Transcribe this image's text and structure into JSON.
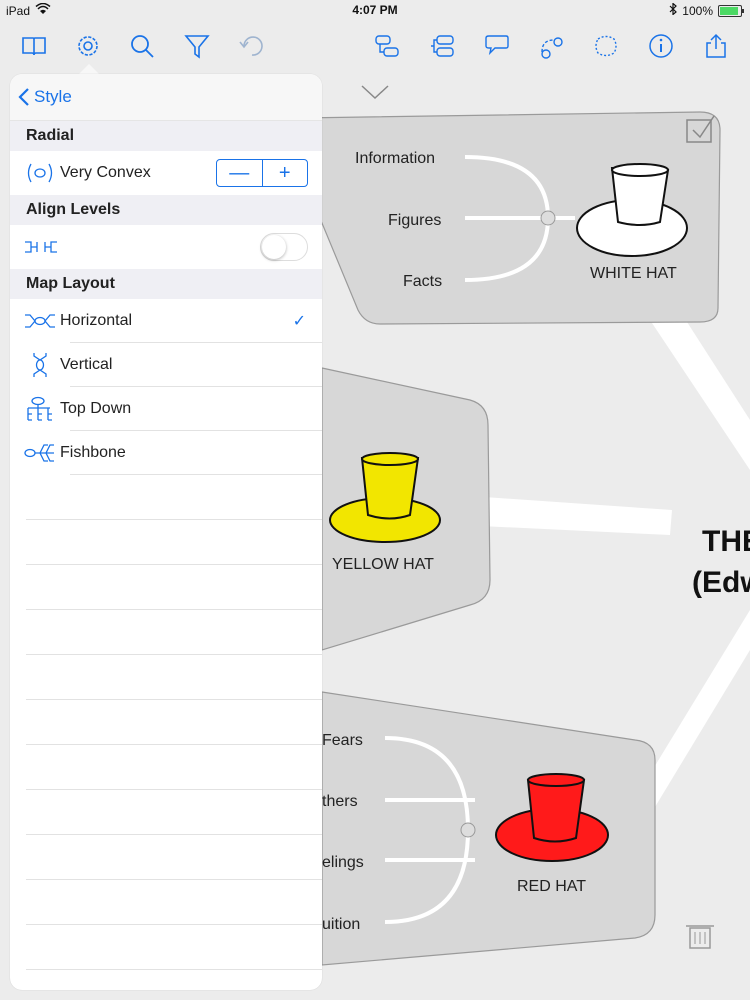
{
  "status": {
    "device": "iPad",
    "time": "4:07 PM",
    "battery": "100%",
    "battery_level": 1.0
  },
  "toolbar": {
    "icons": [
      "book-icon",
      "settings-gear-icon",
      "search-icon",
      "filter-icon",
      "undo-icon",
      "topic-icon",
      "subtopic-icon",
      "callout-icon",
      "relationship-icon",
      "boundary-icon",
      "info-icon",
      "share-icon"
    ]
  },
  "popover": {
    "back_label": "Style",
    "radial": {
      "section": "Radial",
      "value_label": "Very Convex",
      "minus": "—",
      "plus": "+"
    },
    "align": {
      "section": "Align Levels",
      "enabled": false
    },
    "layout": {
      "section": "Map Layout",
      "options": [
        {
          "label": "Horizontal",
          "selected": true
        },
        {
          "label": "Vertical",
          "selected": false
        },
        {
          "label": "Top Down",
          "selected": false
        },
        {
          "label": "Fishbone",
          "selected": false
        }
      ],
      "check": "✓"
    }
  },
  "map": {
    "white_hat": {
      "title": "WHITE HAT",
      "items": [
        "Information",
        "Figures",
        "Facts"
      ],
      "color": "#ffffff"
    },
    "yellow_hat": {
      "title": "YELLOW HAT",
      "color": "#f2e600"
    },
    "red_hat": {
      "title": "RED HAT",
      "items": [
        "Fears",
        "thers",
        "elings",
        "uition"
      ],
      "color": "#ff1a1a"
    },
    "central": {
      "line1": "THE",
      "line2": "(Edw"
    }
  },
  "colors": {
    "accent": "#1a73e8",
    "panel": "#d8d8d8"
  }
}
